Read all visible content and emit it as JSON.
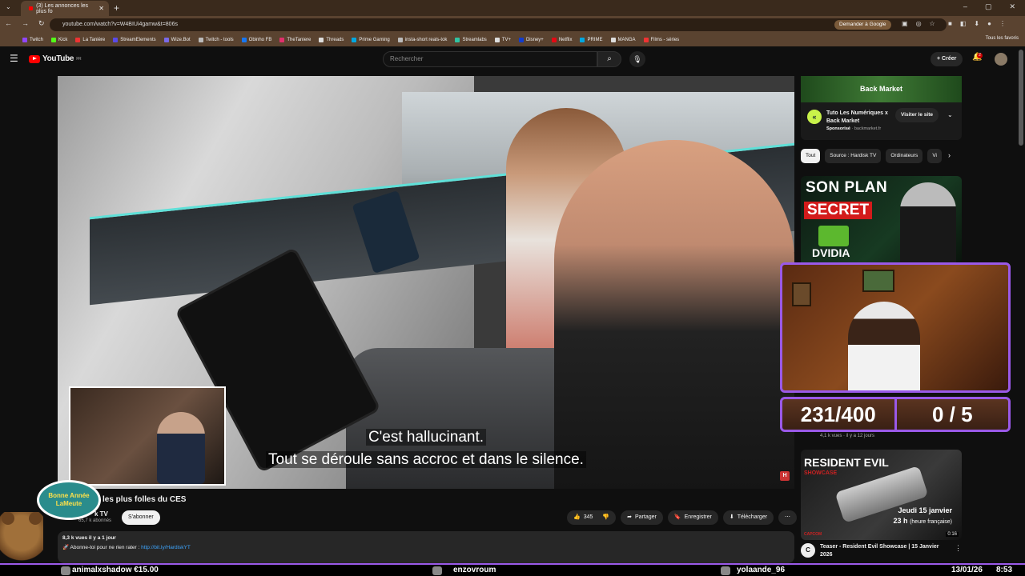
{
  "browser": {
    "tab_title": "(3) Les annonces les plus fo",
    "new_tab": "+",
    "url": "youtube.com/watch?v=W4BIUi4gamw&t=806s",
    "google_pill": "Demander à Google",
    "bookmarks": [
      "Twitch",
      "Kick",
      "La Tanière",
      "StreamElements",
      "Wize.Bot",
      "Twitch - tools",
      "Obinho FB",
      "TheTaniere",
      "Threads",
      "Prime Gaming",
      "insta-short reals-tok",
      "Streamlabs",
      "TV+",
      "Disney+",
      "Netflix",
      "PRIME",
      "MANGA",
      "Films - séries"
    ],
    "all_favorites": "Tous les favoris"
  },
  "youtube": {
    "logo_text": "YouTube",
    "logo_region": "FR",
    "search_placeholder": "Rechercher",
    "create_label": "Créer",
    "notif_count": "2"
  },
  "video": {
    "subtitle_line1": "C'est hallucinant.",
    "subtitle_line2": "Tout se déroule sans accroc et dans le silence.",
    "title": "les plus folles du CES",
    "channel": "k TV",
    "subscribers": "65,7 k abonnés",
    "subscribe_label": "S'abonner",
    "likes": "345",
    "share_label": "Partager",
    "save_label": "Enregistrer",
    "download_label": "Télécharger",
    "desc_meta": "8,3 k vues  il y a 1 jour",
    "desc_text": "Abonne-toi pour ne rien rater : ",
    "desc_link": "http://bit.ly/HardiskYT"
  },
  "sidebar": {
    "ad_brand": "Back Market",
    "ad_title": "Tuto Les Numériques x Back Market",
    "ad_sponsor": "Sponsorisé",
    "ad_domain": "backmarket.fr",
    "ad_visit": "Visiter le site",
    "chips": [
      "Tout",
      "Source : Hardisk TV",
      "Ordinateurs",
      "Vi"
    ],
    "thumb1_line1": "SON PLAN",
    "thumb1_line2": "SECRET",
    "thumb1_line3": "DVIDIA",
    "thumb1_meta": "4,1 k vues · il y a 12 jours",
    "thumb2_title_art": "RESIDENT EVIL",
    "thumb2_sub_art": "SHOWCASE",
    "thumb2_date": "Jeudi 15 janvier",
    "thumb2_time": "23 h",
    "thumb2_tz": "(heure française)",
    "thumb2_duration": "0:16",
    "thumb2_publisher": "CAPCOM",
    "thumb2_title": "Teaser - Resident Evil Showcase | 15 Janvier 2026"
  },
  "overlay": {
    "newyear_line1": "Bonne Année",
    "newyear_line2": "LaMeute",
    "counter_left": "231/400",
    "counter_right": "0 / 5",
    "ticker_1": "animalxshadow €15.00",
    "ticker_2": "enzovroum",
    "ticker_3": "yolaande_96",
    "date": "13/01/26",
    "time": "8:53"
  }
}
